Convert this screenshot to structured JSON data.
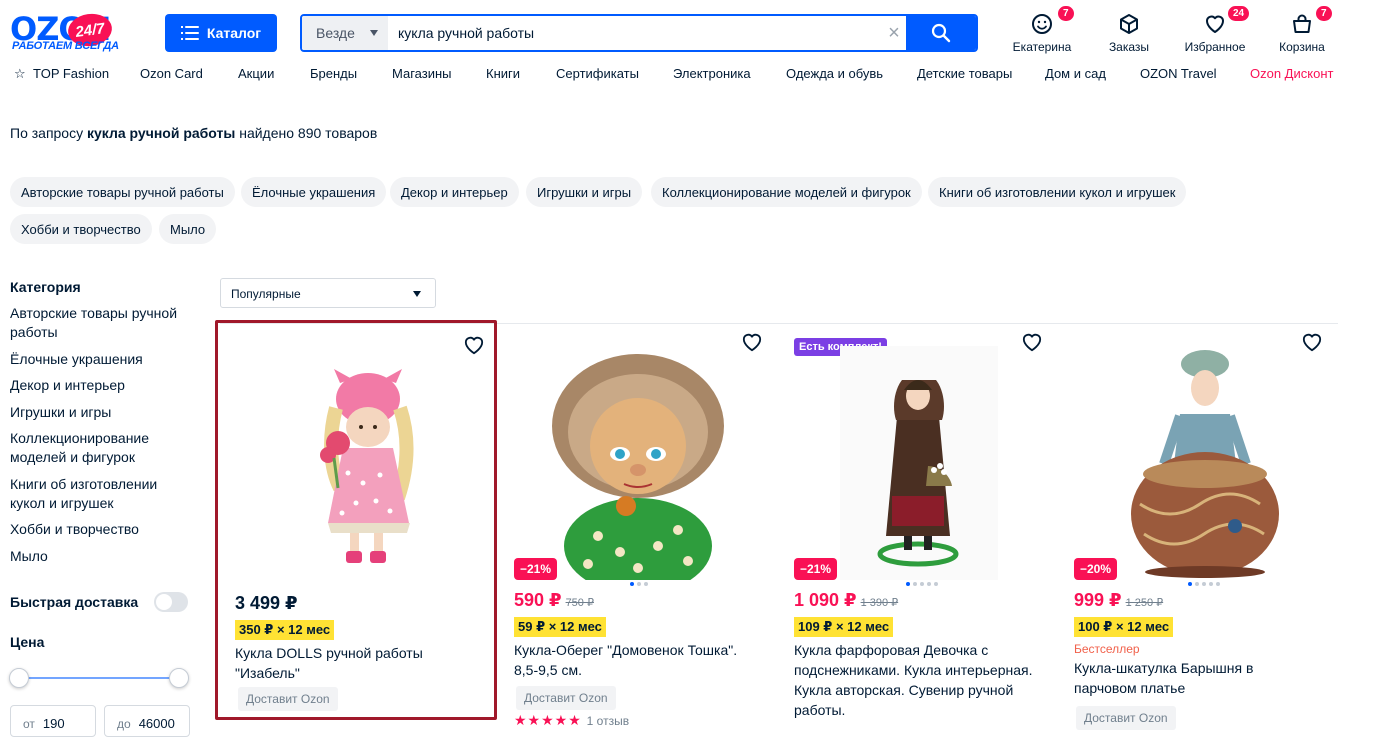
{
  "header": {
    "logo_text": "OZON",
    "logo_badge": "24/7",
    "logo_slogan": "РАБОТАЕМ ВСЕГДА",
    "catalog_label": "Каталог",
    "search_scope": "Везде",
    "search_value": "кукла ручной работы",
    "user": {
      "label": "Екатерина",
      "count": "7"
    },
    "orders": {
      "label": "Заказы"
    },
    "favorites": {
      "label": "Избранное",
      "count": "24"
    },
    "cart": {
      "label": "Корзина",
      "count": "7"
    }
  },
  "nav": [
    "TOP Fashion",
    "Ozon Card",
    "Акции",
    "Бренды",
    "Магазины",
    "Книги",
    "Сертификаты",
    "Электроника",
    "Одежда и обувь",
    "Детские товары",
    "Дом и сад",
    "OZON Travel",
    "Ozon Дисконт"
  ],
  "query": {
    "prefix": "По запросу",
    "term": "кукла ручной работы",
    "suffix": "найдено 890 товаров"
  },
  "chips": [
    "Авторские товары ручной работы",
    "Ёлочные украшения",
    "Декор и интерьер",
    "Игрушки и игры",
    "Коллекционирование моделей и фигурок",
    "Книги об изготовлении кукол и игрушек",
    "Хобби и творчество",
    "Мыло"
  ],
  "sidebar": {
    "category_title": "Категория",
    "categories": [
      "Авторские товары ручной работы",
      "Ёлочные украшения",
      "Декор и интерьер",
      "Игрушки и игры",
      "Коллекционирование моделей и фигурок",
      "Книги об изготовлении кукол и игрушек",
      "Хобби и творчество",
      "Мыло"
    ],
    "fast_delivery": "Быстрая доставка",
    "price_title": "Цена",
    "price_from_label": "от",
    "price_from": "190",
    "price_to_label": "до",
    "price_to": "46000"
  },
  "sort": {
    "selected": "Популярные"
  },
  "products": [
    {
      "price": "3 499 ₽",
      "old_price": "",
      "discount": "",
      "installment": "350 ₽ × 12 мес",
      "title": "Кукла DOLLS ручной работы \"Изабель\"",
      "delivery": "Доставит Ozon"
    },
    {
      "price": "590 ₽",
      "old_price": "750 ₽",
      "discount": "−21%",
      "installment": "59 ₽ × 12 мес",
      "title": "Кукла-Оберег \"Домовенок Тошка\". 8,5-9,5 см.",
      "delivery": "Доставит Ozon",
      "reviews": "1 отзыв"
    },
    {
      "price": "1 090 ₽",
      "old_price": "1 390 ₽",
      "discount": "−21%",
      "badge": "Есть комплект!",
      "installment": "109 ₽ × 12 мес",
      "title": "Кукла фарфоровая Девочка с подснежниками. Кукла интерьерная. Кукла авторская. Сувенир ручной работы."
    },
    {
      "price": "999 ₽",
      "old_price": "1 250 ₽",
      "discount": "−20%",
      "tag": "Бестселлер",
      "installment": "100 ₽ × 12 мес",
      "title": "Кукла-шкатулка Барышня в парчовом платье",
      "delivery": "Доставит Ozon"
    }
  ],
  "colors": {
    "accent": "#005bff",
    "sale": "#f91155",
    "installment": "#ffe234",
    "selection": "#a0182a"
  }
}
